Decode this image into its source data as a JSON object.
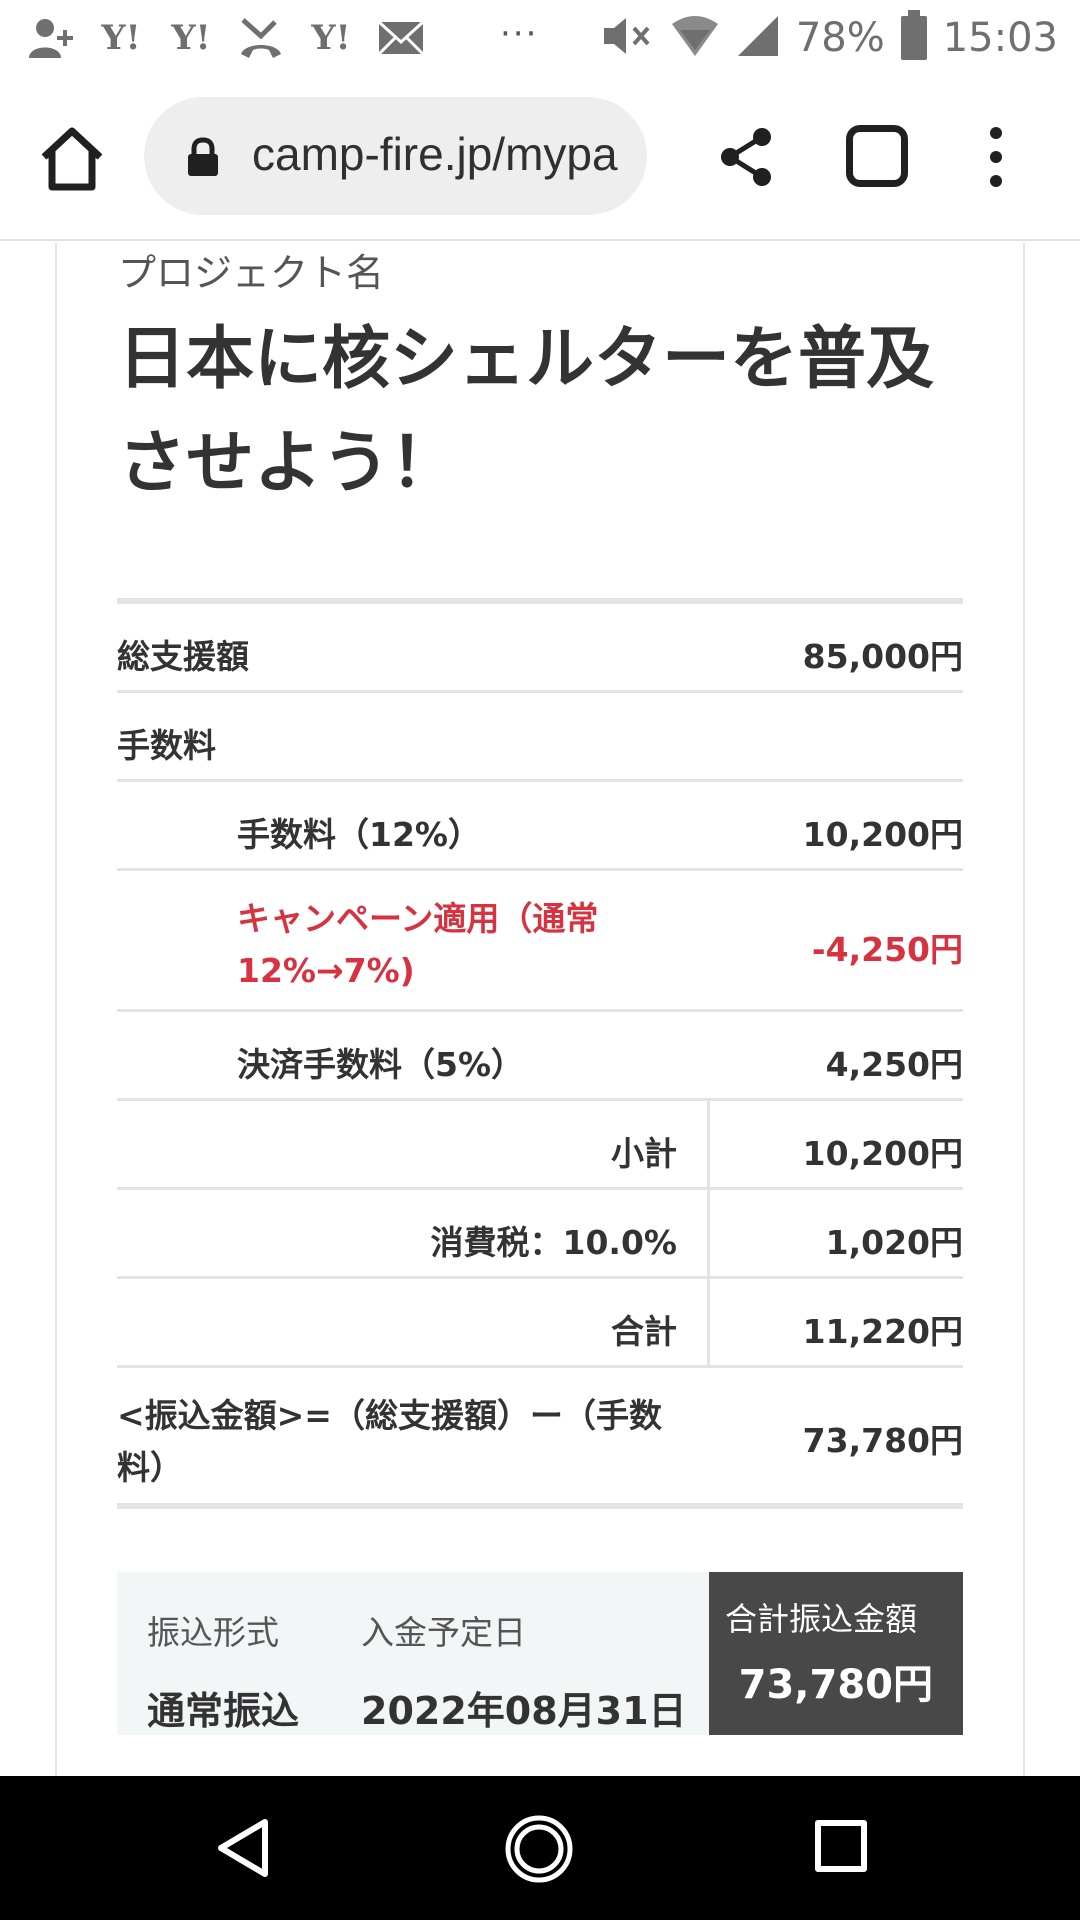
{
  "status_bar": {
    "left_icons": [
      "person-add-icon",
      "yahoo-icon",
      "yahoo-icon",
      "missed-call-icon",
      "yahoo-icon",
      "mail-icon"
    ],
    "yahoo_text": "Y!",
    "more_dots": "···",
    "battery_percent": "78%",
    "time": "15:03"
  },
  "browser": {
    "url": "camp-fire.jp/mypa"
  },
  "project": {
    "label": "プロジェクト名",
    "title": "日本に核シェルターを普及させよう！"
  },
  "fees": {
    "total_support": {
      "label": "総支援額",
      "value": "85,000円"
    },
    "fee_header": {
      "label": "手数料"
    },
    "fee_12": {
      "label": "手数料（12%）",
      "value": "10,200円"
    },
    "campaign": {
      "label_line1": "キャンペーン適用（通常",
      "label_line2": "12%→7%)",
      "value": "-4,250円"
    },
    "payment_fee": {
      "label": "決済手数料（5%）",
      "value": "4,250円"
    },
    "subtotal": {
      "label": "小計",
      "value": "10,200円"
    },
    "tax": {
      "label": "消費税：10.0%",
      "value": "1,020円"
    },
    "total": {
      "label": "合計",
      "value": "11,220円"
    },
    "transfer": {
      "label_line1": "<振込金額>=（総支援額）ー（手数",
      "label_line2": "料）",
      "value": "73,780円"
    }
  },
  "summary": {
    "transfer_type_label": "振込形式",
    "transfer_type_value": "通常振込",
    "deposit_date_label": "入金予定日",
    "deposit_date_value": "2022年08月31日",
    "total_label": "合計振込金額",
    "total_value": "73,780円"
  },
  "colors": {
    "campaign_red": "#d7323f",
    "summary_dark": "#484848",
    "summary_light": "#f3f6f7"
  }
}
